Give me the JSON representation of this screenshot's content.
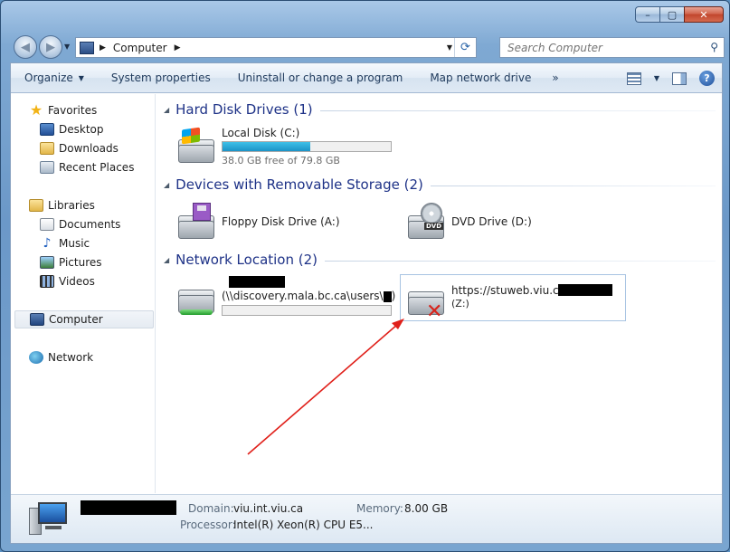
{
  "window": {
    "caption_minimize": "–",
    "caption_maximize": "▢",
    "caption_close": "✕"
  },
  "address": {
    "location": "Computer"
  },
  "search": {
    "placeholder": "Search Computer"
  },
  "toolbar": {
    "organize": "Organize",
    "system_properties": "System properties",
    "uninstall": "Uninstall or change a program",
    "map_network_drive": "Map network drive",
    "more": "»"
  },
  "sidebar": {
    "favorites": "Favorites",
    "favorites_items": [
      "Desktop",
      "Downloads",
      "Recent Places"
    ],
    "libraries": "Libraries",
    "libraries_items": [
      "Documents",
      "Music",
      "Pictures",
      "Videos"
    ],
    "computer": "Computer",
    "network": "Network"
  },
  "groups": {
    "hard_disk": {
      "title": "Hard Disk Drives (1)",
      "drives": [
        {
          "name": "Local Disk (C:)",
          "free_text": "38.0 GB free of 79.8 GB",
          "used_fraction": 0.524
        }
      ]
    },
    "removable": {
      "title": "Devices with Removable Storage (2)",
      "drives": [
        {
          "name": "Floppy Disk Drive (A:)"
        },
        {
          "name": "DVD Drive (D:)"
        }
      ]
    },
    "network": {
      "title": "Network Location (2)",
      "drives": [
        {
          "name": "(\\\\discovery.mala.bc.ca\\users\\",
          "name_suffix": ") ...",
          "used_fraction": 0.0
        },
        {
          "name": "https://stuweb.viu.ca/",
          "sub": "(Z:)"
        }
      ]
    }
  },
  "details": {
    "domain_label": "Domain:",
    "domain_value": "viu.int.viu.ca",
    "memory_label": "Memory:",
    "memory_value": "8.00 GB",
    "processor_label": "Processor:",
    "processor_value": "Intel(R) Xeon(R) CPU E5..."
  },
  "colors": {
    "annotation_arrow": "#e0201a",
    "group_title": "#1e3287",
    "bar_fill": "#26a7d6"
  }
}
